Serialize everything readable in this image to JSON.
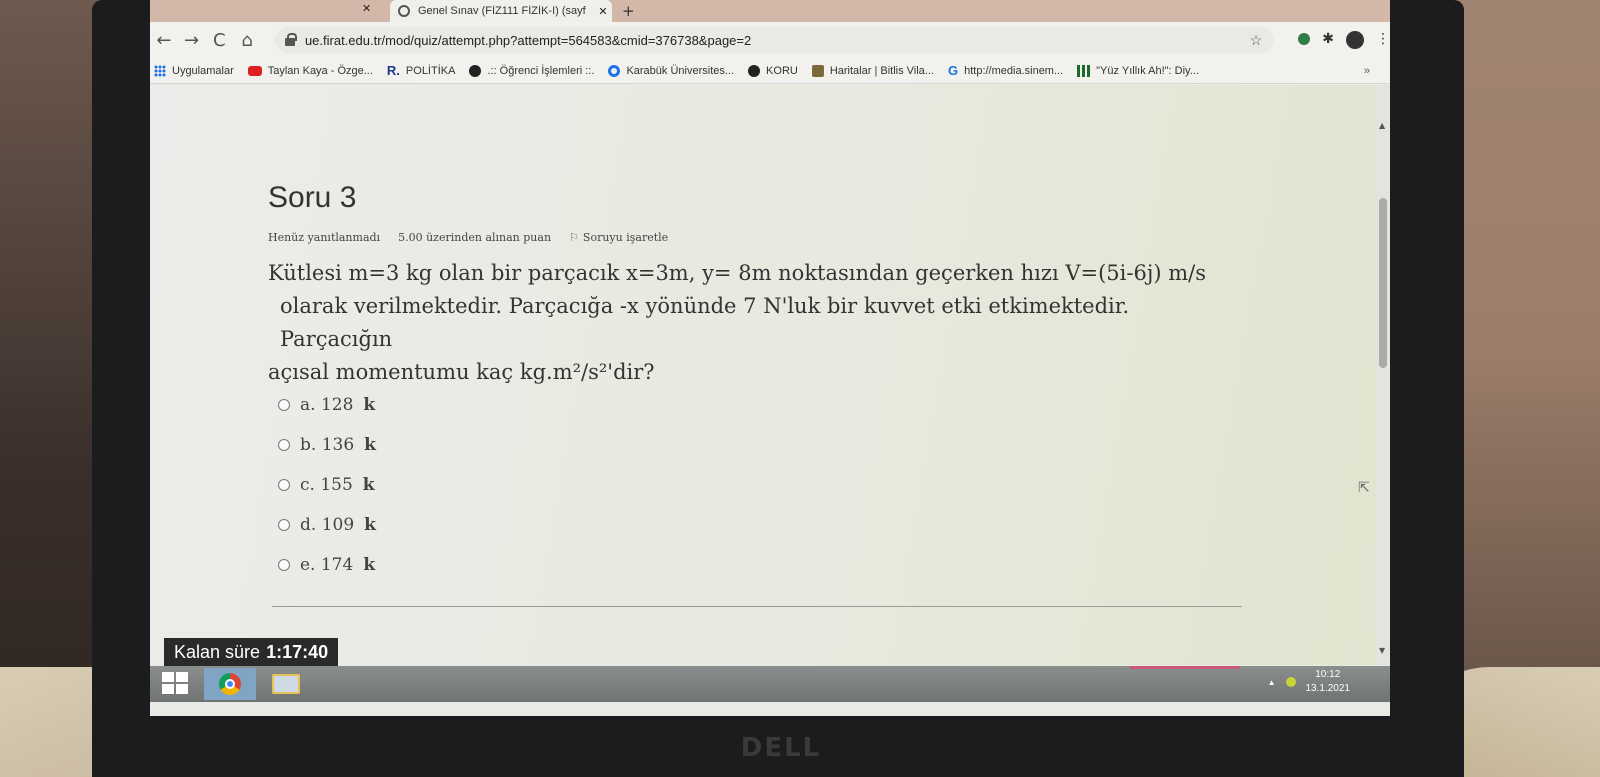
{
  "browser": {
    "tab_title": "Genel Sınav (FİZ111 FİZİK-I) (sayf",
    "tab_close": "✕",
    "prev_tab_close": "✕",
    "new_tab": "+",
    "window_close": "✕",
    "url": "ue.firat.edu.tr/mod/quiz/attempt.php?attempt=564583&cmid=376738&page=2",
    "nav": {
      "back": "←",
      "forward": "→",
      "reload": "C",
      "home": "⌂"
    },
    "star": "☆",
    "menu": "⋮"
  },
  "bookmarks": [
    {
      "label": "Uygulamalar",
      "icon": "apps-grid-icon"
    },
    {
      "label": "Taylan Kaya - Özge...",
      "icon": "youtube-icon"
    },
    {
      "label": "POLİTİKA",
      "icon": "r-logo-icon"
    },
    {
      "label": ".:: Öğrenci İşlemleri ::.",
      "icon": "globe-icon"
    },
    {
      "label": "Karabük Üniversites...",
      "icon": "circle-icon"
    },
    {
      "label": "KORU",
      "icon": "globe-icon"
    },
    {
      "label": "Haritalar | Bitlis Vila...",
      "icon": "map-icon"
    },
    {
      "label": "http://media.sinem...",
      "icon": "google-icon"
    },
    {
      "label": "\"Yüz Yıllık Ah!\": Diy...",
      "icon": "bars-icon"
    }
  ],
  "bookmarks_more": "»",
  "quiz": {
    "title": "Soru 3",
    "status": "Henüz yanıtlanmadı",
    "grade": "5.00 üzerinden alınan puan",
    "flag_label": "Soruyu işaretle",
    "question_line1": "Kütlesi m=3 kg olan bir parçacık x=3m, y= 8m noktasından geçerken hızı V=(5i-6j) m/s",
    "question_line2": "olarak verilmektedir. Parçacığa -x yönünde 7 N'luk bir kuvvet etki etkimektedir. Parçacığın",
    "question_line3": "açısal momentumu kaç kg.m²/s²'dir?",
    "answers": [
      {
        "prefix": "a. 128",
        "unit": "k"
      },
      {
        "prefix": "b. 136",
        "unit": "k"
      },
      {
        "prefix": "c. 155",
        "unit": "k"
      },
      {
        "prefix": "d. 109",
        "unit": "k"
      },
      {
        "prefix": "e. 174",
        "unit": "k"
      }
    ],
    "timer_label": "Kalan süre",
    "timer_value": "1:17:40"
  },
  "taskbar": {
    "time": "10:12",
    "date": "13.1.2021"
  },
  "brand": "DELL"
}
